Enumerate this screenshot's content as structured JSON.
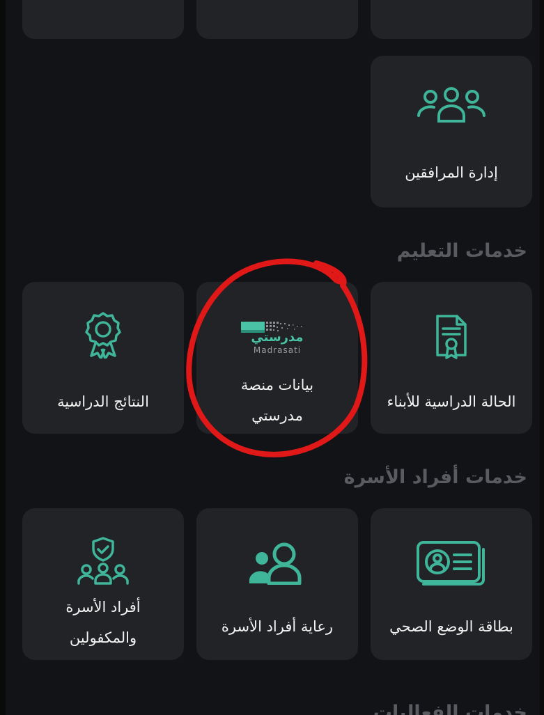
{
  "accent_color": "#3fb59a",
  "top_row": {
    "items": [
      {
        "label": "…",
        "icon": "service-icon"
      },
      {
        "label": "…",
        "icon": "service-icon"
      },
      {
        "label": "…",
        "icon": "service-icon"
      }
    ]
  },
  "escorts": {
    "label": "إدارة المرافقين",
    "icon": "people-group-icon"
  },
  "education": {
    "title": "خدمات التعليم",
    "items": [
      {
        "label": "الحالة الدراسية للأبناء",
        "icon": "certificate-document-icon"
      },
      {
        "label_line1": "بيانات منصة",
        "label_line2": "مدرستي",
        "icon": "madrasati-logo",
        "logo_text": "مدرستي",
        "logo_latin": "Madrasati"
      },
      {
        "label": "النتائج الدراسية",
        "icon": "award-ribbon-icon"
      }
    ]
  },
  "family": {
    "title": "خدمات أفراد الأسرة",
    "items": [
      {
        "label": "بطاقة الوضع الصحي",
        "icon": "id-card-icon"
      },
      {
        "label": "رعاية أفراد الأسرة",
        "icon": "person-care-icon"
      },
      {
        "label_line1": "أفراد الأسرة",
        "label_line2": "والمكفولين",
        "icon": "family-shield-icon"
      }
    ]
  },
  "events": {
    "title": "خدمات الفعاليات"
  }
}
